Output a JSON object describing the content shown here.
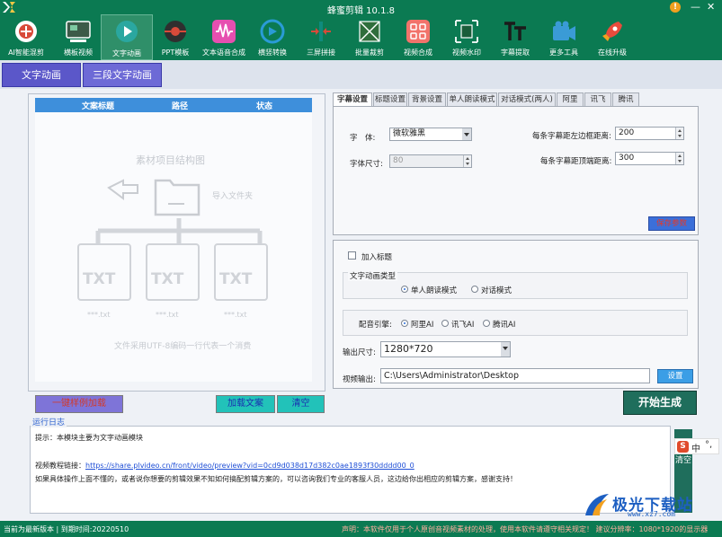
{
  "window": {
    "title": "蜂蜜剪辑 10.1.8",
    "help_glyph": "!",
    "minimize_glyph": "—",
    "close_glyph": "✕"
  },
  "toolbar": [
    {
      "label": "AI智能混剪",
      "icon": "ai-mix-icon",
      "color": "#ffffff"
    },
    {
      "label": "横板视频",
      "icon": "horizontal-video-icon",
      "color": "#3c5a48"
    },
    {
      "label": "文字动画",
      "icon": "text-animation-icon",
      "color": "#2aa7a0"
    },
    {
      "label": "PPT模板",
      "icon": "ppt-template-icon",
      "color": "#2f2f2f"
    },
    {
      "label": "文本语音合成",
      "icon": "tts-icon",
      "color": "#e64fb0"
    },
    {
      "label": "横竖转换",
      "icon": "rotate-icon",
      "color": "#2a9bd6"
    },
    {
      "label": "三屏拼接",
      "icon": "three-screen-icon",
      "color": "#0f8b7c"
    },
    {
      "label": "批量裁剪",
      "icon": "batch-crop-icon",
      "color": "#2f6e3c"
    },
    {
      "label": "视频合成",
      "icon": "video-merge-icon",
      "color": "#f2736b"
    },
    {
      "label": "视频水印",
      "icon": "watermark-icon",
      "color": "#1a5d3a"
    },
    {
      "label": "字幕提取",
      "icon": "subtitle-extract-icon",
      "color": "#f1f1f1"
    },
    {
      "label": "更多工具",
      "icon": "more-tools-icon",
      "color": "#3a9bd6"
    },
    {
      "label": "在线升级",
      "icon": "upgrade-rocket-icon",
      "color": "#e84b3c"
    }
  ],
  "mode_tabs": [
    "文字动画",
    "三段文字动画"
  ],
  "file_table": {
    "columns": [
      "文案标题",
      "路径",
      "状态"
    ],
    "placeholder_title": "素材项目结构图",
    "placeholder_import": "导入文件夹",
    "file_labels": [
      "TXT",
      "TXT",
      "TXT"
    ],
    "file_names": [
      "***.txt",
      "***.txt",
      "***.txt"
    ],
    "note": "文件采用UTF-8编码一行代表一个消费"
  },
  "left_buttons": {
    "one_click": "一键样例加载",
    "load_copy": "加载文案",
    "clear": "清空"
  },
  "settings_tabs": [
    "字幕设置",
    "标题设置",
    "背景设置",
    "单人朗读模式",
    "对话模式(两人)",
    "阿里",
    "讯飞",
    "腾讯"
  ],
  "subtitle_settings": {
    "font_label": "字　体:",
    "font_value": "微软雅黑",
    "size_label": "字体尺寸:",
    "size_value": "80",
    "left_margin_label": "每条字幕距左边框距离:",
    "left_margin_value": "200",
    "top_margin_label": "每条字幕距顶端距离:",
    "top_margin_value": "300",
    "save_button": "保存参数"
  },
  "output": {
    "add_title_label": "加入标题",
    "animation_type_label": "文字动画类型",
    "mode_single": "单人朗读模式",
    "mode_dialog": "对话模式",
    "voice_engine_label": "配音引擎:",
    "engines": [
      "阿里AI",
      "讯飞AI",
      "腾讯AI"
    ],
    "size_label": "输出尺寸:",
    "size_value": "1280*720",
    "output_label": "视频输出:",
    "output_path": "C:\\Users\\Administrator\\Desktop",
    "settings_button": "设置"
  },
  "generate_button": "开始生成",
  "log": {
    "legend": "运行日志",
    "line1": "提示：本模块主要为文字动画模块",
    "line2_label": "视频教程链接：",
    "line2_link": "https://share.plvideo.cn/front/video/preview?vid=0cd9d038d17d382c0ae1893f30dddd00_0",
    "line3": "如果具体操作上面不懂的，或者说你想要的剪辑效果不知如何搞配剪辑方案的，可以咨询我们专业的客服人员，这边给你出相应的剪辑方案，感谢支持！",
    "clear_button": "清空"
  },
  "ime": {
    "badge": "S",
    "lang": "中",
    "punct": "°,"
  },
  "watermark": {
    "text": "极光下载站",
    "sub": "www.xz7.com"
  },
  "status": {
    "left": "当前为最新版本 | 到期时间:20220510",
    "right": "声明：本软件仅用于个人原创音视频素材的处理，使用本软件请遵守相关规定！ 建议分辨率：1080*1920的显示器"
  }
}
